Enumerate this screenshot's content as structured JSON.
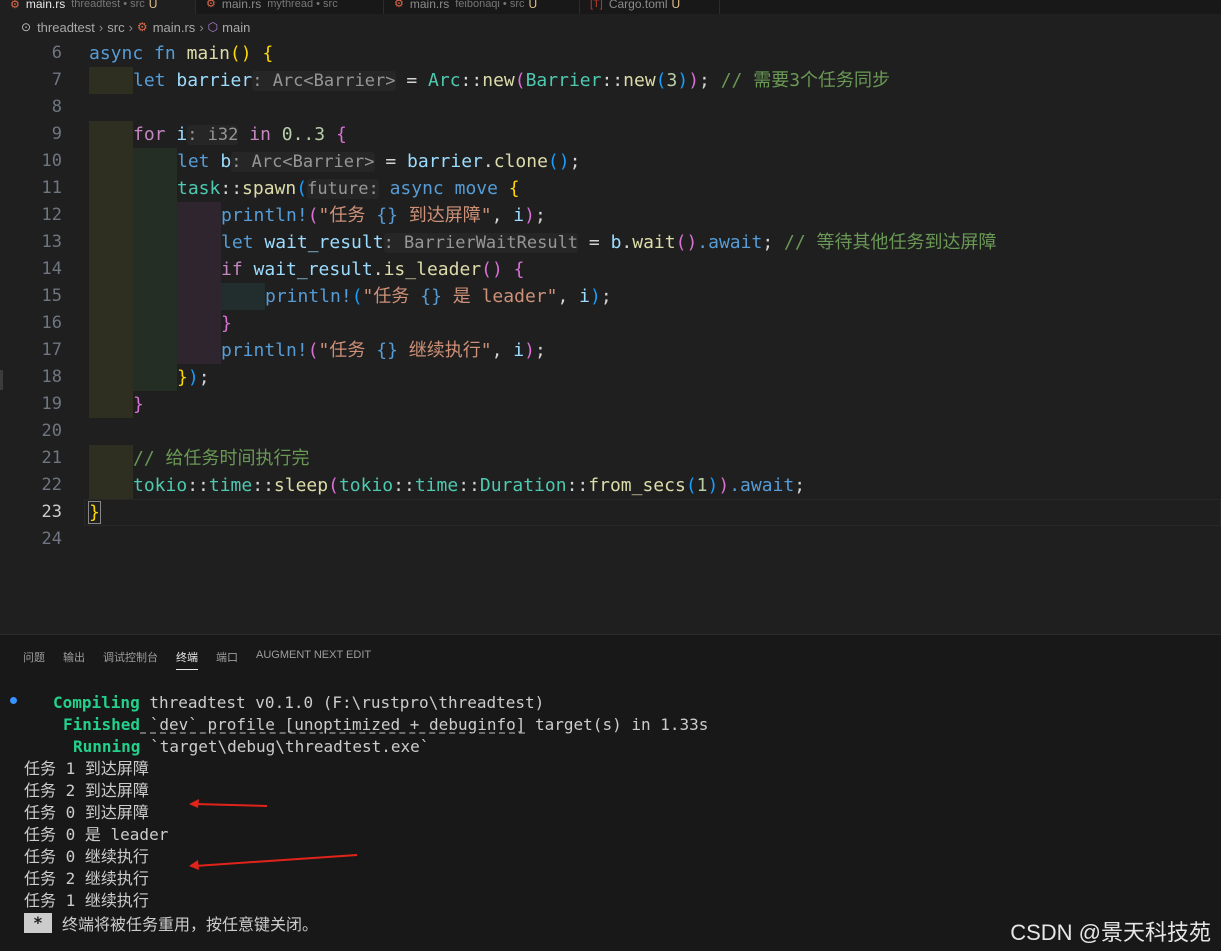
{
  "tabs": [
    {
      "name": "main.rs",
      "desc": "threadtest • src",
      "modified": "U",
      "active": true
    },
    {
      "name": "main.rs",
      "desc": "mythread • src",
      "modified": "",
      "active": false
    },
    {
      "name": "main.rs",
      "desc": "feibonaqi • src",
      "modified": "U",
      "active": false
    },
    {
      "name": "Cargo.toml",
      "desc": "",
      "modified": "U",
      "active": false
    }
  ],
  "breadcrumb": {
    "project": "threadtest",
    "folder": "src",
    "file": "main.rs",
    "symbol": "main"
  },
  "editor": {
    "current_line": 23,
    "line_numbers": [
      "6",
      "7",
      "8",
      "9",
      "10",
      "11",
      "12",
      "13",
      "14",
      "15",
      "16",
      "17",
      "18",
      "19",
      "20",
      "21",
      "22",
      "23",
      "24"
    ],
    "code": {
      "l6": {
        "async": "async",
        "fn": "fn",
        "name": "main",
        "paren": "()",
        "brace": "{"
      },
      "l7": {
        "let": "let",
        "var": "barrier",
        "hint": ": Arc<Barrier>",
        "eq": " = ",
        "t1": "Arc",
        "p1": "::",
        "f1": "new",
        "o1": "(",
        "t2": "Barrier",
        "p2": "::",
        "f2": "new",
        "o2": "(",
        "num": "3",
        "c2": ")",
        "c1": ")",
        "semi": ";",
        "comment": " // 需要3个任务同步"
      },
      "l9": {
        "for": "for",
        "var": "i",
        "hint": ": i32",
        "in": " in ",
        "range": "0..3",
        "brace": " {"
      },
      "l10": {
        "let": "let",
        "var": "b",
        "hint": ": Arc<Barrier>",
        "eq": " = ",
        "obj": "barrier",
        "dot": ".",
        "fn": "clone",
        "paren": "()",
        "semi": ";"
      },
      "l11": {
        "mod": "task",
        "p": "::",
        "fn": "spawn",
        "o": "(",
        "hint": "future:",
        "async": " async",
        "move": " move",
        "brace": " {"
      },
      "l12": {
        "mac": "println!",
        "o": "(",
        "s1": "\"任务 ",
        "ph": "{}",
        "s2": " 到达屏障\"",
        "rest": ", ",
        "var": "i",
        "c": ")",
        "semi": ";"
      },
      "l13": {
        "let": "let",
        "var": "wait_result",
        "hint": ": BarrierWaitResult",
        "eq": " = ",
        "obj": "b",
        "dot": ".",
        "fn": "wait",
        "paren": "()",
        "aw": ".await",
        "semi": ";",
        "comment": " // 等待其他任务到达屏障"
      },
      "l14": {
        "if": "if",
        "var": "wait_result",
        "dot": ".",
        "fn": "is_leader",
        "paren": "()",
        "brace": " {"
      },
      "l15": {
        "mac": "println!",
        "o": "(",
        "s1": "\"任务 ",
        "ph": "{}",
        "s2": " 是 leader\"",
        "rest": ", ",
        "var": "i",
        "c": ")",
        "semi": ";"
      },
      "l16": {
        "brace": "}"
      },
      "l17": {
        "mac": "println!",
        "o": "(",
        "s1": "\"任务 ",
        "ph": "{}",
        "s2": " 继续执行\"",
        "rest": ", ",
        "var": "i",
        "c": ")",
        "semi": ";"
      },
      "l18": {
        "brace": "}",
        "paren": ")",
        "semi": ";"
      },
      "l19": {
        "brace": "}"
      },
      "l21": {
        "comment": "// 给任务时间执行完"
      },
      "l22": {
        "m1": "tokio",
        "p1": "::",
        "m2": "time",
        "p2": "::",
        "fn": "sleep",
        "o1": "(",
        "m3": "tokio",
        "p3": "::",
        "m4": "time",
        "p4": "::",
        "ty": "Duration",
        "p5": "::",
        "fn2": "from_secs",
        "o2": "(",
        "num": "1",
        "c2": ")",
        "c1": ")",
        "aw": ".await",
        "semi": ";"
      },
      "l23": {
        "brace": "}"
      }
    }
  },
  "panel": {
    "tabs": [
      "问题",
      "输出",
      "调试控制台",
      "终端",
      "端口",
      "AUGMENT NEXT EDIT"
    ],
    "active_tab": "终端",
    "terminal": {
      "compiling_label": "Compiling",
      "compiling_text": " threadtest v0.1.0 (F:\\rustpro\\threadtest)",
      "finished_label": "Finished",
      "finished_text_a": " `dev` profile [unoptimized + debuginfo]",
      "finished_text_b": " target(s) in 1.33s",
      "running_label": "Running",
      "running_text": " `target\\debug\\threadtest.exe`",
      "output": [
        "任务 1 到达屏障",
        "任务 2 到达屏障",
        "任务 0 到达屏障",
        "任务 0 是 leader",
        "任务 0 继续执行",
        "任务 2 继续执行",
        "任务 1 继续执行"
      ],
      "close_star": "*",
      "close_message": "终端将被任务重用，按任意键关闭。"
    },
    "arrow_color": "#e2231a"
  },
  "watermark": "CSDN @景天科技苑"
}
